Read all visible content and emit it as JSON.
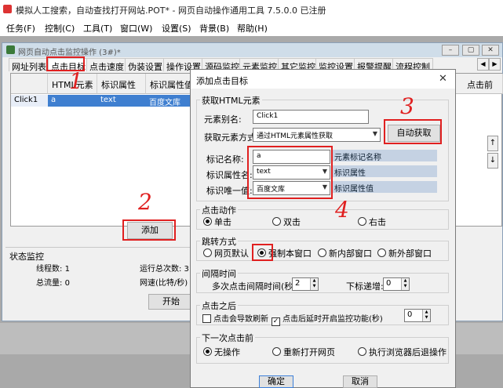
{
  "window": {
    "title": "模拟人工搜索，自动查找打开网站.POT* - 网页自动操作通用工具 7.5.0.0 已注册"
  },
  "menu": [
    "任务(F)",
    "控制(C)",
    "工具(T)",
    "窗口(W)",
    "设置(S)",
    "背景(B)",
    "帮助(H)"
  ],
  "inner": {
    "title": "网页自动点击监控操作 (3#)*",
    "win_buttons": [
      "–",
      "▢",
      "✕"
    ],
    "tabs": [
      "网址列表",
      "点击目标",
      "点击速度",
      "伪装设置",
      "操作设置",
      "源码监控",
      "元素监控",
      "其它监控",
      "监控设置",
      "报警提醒",
      "流程控制"
    ],
    "tab_arrows": [
      "◀",
      "▶"
    ],
    "grid_headers": [
      "",
      "HTML元素",
      "标识属性",
      "标识属性值",
      "点击前"
    ],
    "grid_row": [
      "Click1",
      "a",
      "text",
      "百度文库"
    ],
    "side_arrows": [
      "↑",
      "↓"
    ],
    "add_button": "添加",
    "status": {
      "title": "状态监控",
      "thread_label": "线程数: ",
      "thread_value": "1",
      "total_label": "总流量: ",
      "total_value": "0",
      "runs_label": "运行总次数: 3",
      "speed_label": "网速(比特/秒)",
      "start_button": "开始"
    }
  },
  "dialog": {
    "title": "添加点击目标",
    "close": "✕",
    "get_element": {
      "title": "获取HTML元素",
      "alias_label": "元素别名:",
      "alias_value": "Click1",
      "method_label": "获取元素方式:",
      "method_value": "通过HTML元素属性获取",
      "auto_button": "自动获取",
      "tag_label": "标记名称:",
      "tag_value": "a",
      "tag_hint": "元素标记名称",
      "attr_label": "标识属性名:",
      "attr_value": "text",
      "attr_hint": "标识属性",
      "unique_label": "标识唯一值:",
      "unique_value": "百度文库",
      "unique_hint": "标识属性值"
    },
    "click_action": {
      "title": "点击动作",
      "options": [
        "单击",
        "双击",
        "右击"
      ],
      "selected": 0
    },
    "jump": {
      "title": "跳转方式",
      "options": [
        "网页默认",
        "强制本窗口",
        "新内部窗口",
        "新外部窗口"
      ],
      "selected": 1
    },
    "interval": {
      "title": "间隔时间",
      "multi_label": "多次点击间隔时间(秒):",
      "multi_value": "2",
      "step_label": "下标递增:",
      "step_value": "0"
    },
    "after": {
      "title": "点击之后",
      "refresh_label": "点击会导致刷新",
      "refresh_checked": false,
      "delay_label": "点击后延时开启监控功能(秒)",
      "delay_checked": true,
      "delay_value": "0"
    },
    "next": {
      "title": "下一次点击前",
      "options": [
        "无操作",
        "重新打开网页",
        "执行浏览器后退操作"
      ],
      "selected": 0
    },
    "ok_button": "确定",
    "cancel_button": "取消"
  },
  "annotations": [
    "1",
    "2",
    "3",
    "4"
  ]
}
